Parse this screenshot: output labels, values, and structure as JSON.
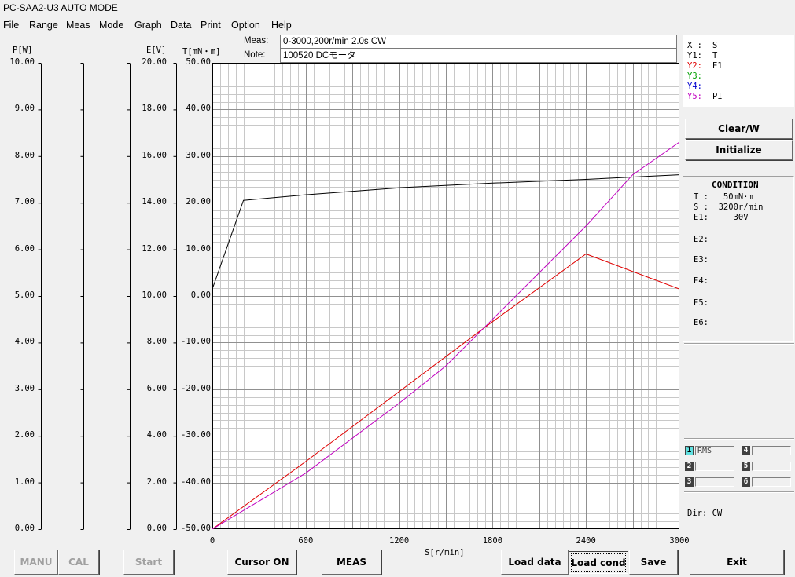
{
  "window": {
    "title": "PC-SAA2-U3 AUTO MODE"
  },
  "menu": [
    "File",
    "Range",
    "Meas",
    "Mode",
    "Graph",
    "Data",
    "Print",
    "Option",
    "Help"
  ],
  "header": {
    "meas_label": "Meas:",
    "meas_value": "0-3000,200r/min 2.0s CW",
    "note_label": "Note:",
    "note_value": "100520 DCモータ"
  },
  "axes": {
    "p": {
      "unit": "P[W]",
      "ticks": [
        "10.00",
        "9.00",
        "8.00",
        "7.00",
        "6.00",
        "5.00",
        "4.00",
        "3.00",
        "2.00",
        "1.00",
        "0.00"
      ]
    },
    "e": {
      "unit": "E[V]",
      "ticks": [
        "20.00",
        "18.00",
        "16.00",
        "14.00",
        "12.00",
        "10.00",
        "8.00",
        "6.00",
        "4.00",
        "2.00",
        "0.00"
      ]
    },
    "t": {
      "unit": "T[mN・m]",
      "ticks": [
        "50.00",
        "40.00",
        "30.00",
        "20.00",
        "10.00",
        "0.00",
        "-10.00",
        "-20.00",
        "-30.00",
        "-40.00",
        "-50.00"
      ]
    },
    "s": {
      "unit": "S[r/min]",
      "ticks": [
        "0",
        "600",
        "1200",
        "1800",
        "2400",
        "3000"
      ]
    }
  },
  "chart_data": {
    "type": "line",
    "xlabel": "S[r/min]",
    "xlim": [
      0,
      3000
    ],
    "series": [
      {
        "color": "#000000",
        "axis": "T",
        "ylim": [
          -50,
          50
        ],
        "x": [
          0,
          200,
          600,
          1200,
          1800,
          2400,
          3000
        ],
        "y": [
          1.5,
          20.5,
          21.7,
          23.2,
          24.2,
          25.0,
          26.0
        ]
      },
      {
        "color": "#e00000",
        "axis": "E",
        "ylim": [
          0,
          20
        ],
        "x": [
          0,
          600,
          1200,
          1800,
          2400,
          3000
        ],
        "y": [
          0,
          2.9,
          5.9,
          8.9,
          11.8,
          10.3
        ]
      },
      {
        "color": "#c000c0",
        "axis": "P",
        "ylim": [
          0,
          10
        ],
        "x": [
          0,
          600,
          1200,
          1500,
          1800,
          2400,
          2700,
          3000
        ],
        "y": [
          0,
          1.2,
          2.7,
          3.5,
          4.5,
          6.5,
          7.6,
          8.3
        ]
      }
    ]
  },
  "legend": [
    {
      "key": "X :",
      "value": "S",
      "color": "#000000"
    },
    {
      "key": "Y1:",
      "value": "T",
      "color": "#000000"
    },
    {
      "key": "Y2:",
      "value": "E1",
      "color": "#e00000"
    },
    {
      "key": "Y3:",
      "value": "",
      "color": "#00a000"
    },
    {
      "key": "Y4:",
      "value": "",
      "color": "#0000d0"
    },
    {
      "key": "Y5:",
      "value": "PI",
      "color": "#c000c0"
    }
  ],
  "side_buttons": {
    "clear": "Clear/W",
    "init": "Initialize"
  },
  "condition": {
    "title": "CONDITION",
    "rows": [
      "T :   50mN·m",
      "S :  3200r/min",
      "E1:     30V"
    ],
    "e_labels": [
      "E2:",
      "E3:",
      "E4:",
      "E5:",
      "E6:"
    ]
  },
  "channels": [
    {
      "num": "1",
      "value": "RMS",
      "active": true
    },
    {
      "num": "2",
      "value": ""
    },
    {
      "num": "3",
      "value": ""
    },
    {
      "num": "4",
      "value": ""
    },
    {
      "num": "5",
      "value": ""
    },
    {
      "num": "6",
      "value": ""
    }
  ],
  "dir": "Dir: CW",
  "buttons": {
    "manu": "MANU",
    "cal": "CAL",
    "start": "Start",
    "cursor": "Cursor ON",
    "meas": "MEAS",
    "load_data": "Load data",
    "load_cond": "Load cond",
    "save": "Save",
    "exit": "Exit"
  }
}
